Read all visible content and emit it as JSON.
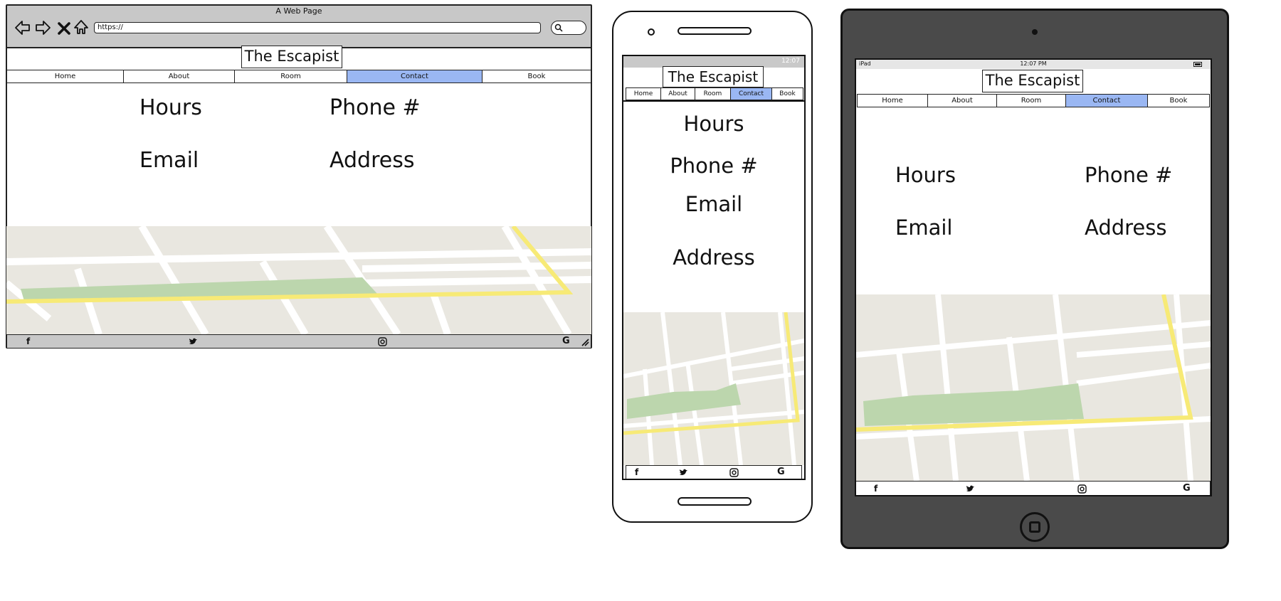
{
  "brand": "The Escapist",
  "nav": [
    {
      "label": "Home",
      "active": false
    },
    {
      "label": "About",
      "active": false
    },
    {
      "label": "Room",
      "active": false
    },
    {
      "label": "Contact",
      "active": true
    },
    {
      "label": "Book",
      "active": false
    }
  ],
  "contact": {
    "hours": "Hours",
    "phone": "Phone #",
    "email": "Email",
    "address": "Address"
  },
  "desktop": {
    "window_title": "A Web Page",
    "url": "https://"
  },
  "phone": {
    "status_time": "12:07"
  },
  "tablet": {
    "status_carrier": "iPad",
    "status_time": "12:07 PM"
  },
  "footer_icons": [
    "facebook-icon",
    "twitter-icon",
    "instagram-icon",
    "google-icon"
  ],
  "colors": {
    "active_tab": "#9ab7f3",
    "map_land": "#e9e7e0",
    "map_park": "#bcd6ad",
    "map_highway": "#f7ea76",
    "tablet_body": "#4a4a4a"
  }
}
